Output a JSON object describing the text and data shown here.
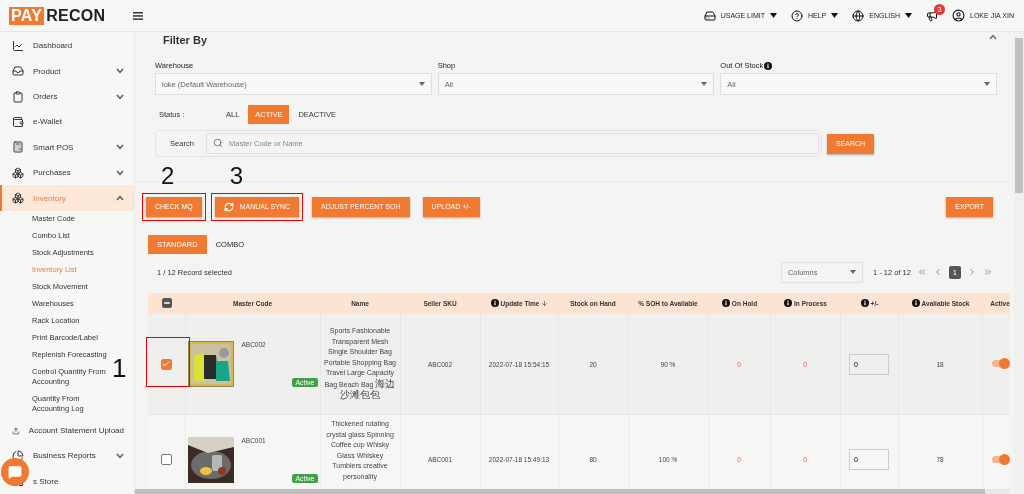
{
  "header": {
    "logo": {
      "part1": "PAY",
      "part2": "RECON"
    },
    "menu": [
      {
        "label": "USAGE LIMIT",
        "kind": "storage"
      },
      {
        "label": "HELP",
        "kind": "help"
      },
      {
        "label": "ENGLISH",
        "kind": "globe"
      }
    ],
    "notifications": {
      "count": "3"
    },
    "user": "LOKE JIA XIN"
  },
  "sidebar": {
    "items": [
      {
        "label": "Dashboard",
        "kind": "chart",
        "selected": false
      },
      {
        "label": "Product",
        "kind": "tray",
        "expanded": false,
        "selected": false
      },
      {
        "label": "Orders",
        "kind": "clipboard",
        "expanded": false,
        "selected": false
      },
      {
        "label": "e-Wallet",
        "kind": "wallet",
        "selected": false
      },
      {
        "label": "Smart POS",
        "kind": "register",
        "expanded": false,
        "selected": false
      },
      {
        "label": "Purchases",
        "kind": "boxes",
        "expanded": false,
        "selected": false
      },
      {
        "label": "Inventory",
        "kind": "boxes",
        "expanded": true,
        "selected": true,
        "children": [
          {
            "label": "Master Code",
            "selected": false
          },
          {
            "label": "Combo List",
            "selected": false
          },
          {
            "label": "Stock Adjustments",
            "selected": false
          },
          {
            "label": "Inventory List",
            "selected": true
          },
          {
            "label": "Stock Movement",
            "selected": false
          },
          {
            "label": "Warehouses",
            "selected": false
          },
          {
            "label": "Rack Location",
            "selected": false
          },
          {
            "label": "Print Barcode/Label",
            "selected": false
          },
          {
            "label": "Replenish Forecasting",
            "selected": false
          },
          {
            "label": "Control Quantity From Accounting",
            "selected": false
          },
          {
            "label": "Quantity From Accounting Log",
            "selected": false
          }
        ]
      },
      {
        "label": "Account Statement Upload",
        "kind": "upload",
        "selected": false
      },
      {
        "label": "Business Reports",
        "kind": "pie",
        "expanded": false,
        "selected": false
      },
      {
        "label": "s Store",
        "kind": "grid",
        "selected": false
      }
    ]
  },
  "filter": {
    "title": "Filter By",
    "fields": [
      {
        "label": "Warehouse",
        "value": "loke (Default Warehouse)",
        "info": false
      },
      {
        "label": "Shop",
        "value": "All",
        "info": false
      },
      {
        "label": "Out Of Stock",
        "value": "All",
        "info": true
      }
    ],
    "status": {
      "label": "Status :",
      "options": [
        {
          "label": "ALL",
          "selected": false
        },
        {
          "label": "ACTIVE",
          "selected": true
        },
        {
          "label": "DEACTIVE",
          "selected": false
        }
      ]
    },
    "search": {
      "label": "Search",
      "placeholder": "Master Code or Name",
      "button": "SEARCH"
    }
  },
  "actions": [
    {
      "label": "CHECK MQ",
      "kind": "plain",
      "annotation": "2"
    },
    {
      "label": "MANUAL SYNC",
      "kind": "sync",
      "annotation": "3"
    },
    {
      "label": "ADJUST PERCENT SOH",
      "kind": "plain"
    },
    {
      "label": "UPLOAD +/-",
      "kind": "plain"
    }
  ],
  "export": "EXPORT",
  "tabs": [
    {
      "label": "STANDARD",
      "selected": true
    },
    {
      "label": "COMBO",
      "selected": false
    }
  ],
  "record_count": "1 / 12 Record selected",
  "columns_select": "Columns",
  "pagination": {
    "range": "1 - 12 of 12",
    "page": "1"
  },
  "table": {
    "select_all_partial": true,
    "columns": [
      {
        "label": "Master Code",
        "info": false,
        "sorted": false
      },
      {
        "label": "Name",
        "info": false,
        "sorted": false
      },
      {
        "label": "Seller SKU",
        "info": false,
        "sorted": false
      },
      {
        "label": "Update Time",
        "info": true,
        "sorted": true
      },
      {
        "label": "Stock on Hand",
        "info": false,
        "sorted": false
      },
      {
        "label": "% SOH to Available",
        "info": false,
        "sorted": false
      },
      {
        "label": "On Hold",
        "info": true,
        "sorted": false
      },
      {
        "label": "In Process",
        "info": true,
        "sorted": false
      },
      {
        "label": "+/-",
        "info": true,
        "sorted": false
      },
      {
        "label": "Available Stock",
        "info": true,
        "sorted": false
      },
      {
        "label": "Active",
        "info": false,
        "sorted": false
      }
    ],
    "rows": [
      {
        "selected": true,
        "annotation": "1",
        "kind": "picture",
        "master_code": "ABC002",
        "status": "Active",
        "name": "Sports Fashionable Transparent Mesh Single Shoulder Bag Portable Shopping Bag Travel Large Capacity Bag Beach Bag 海边沙滩包包",
        "seller_sku": "ABC002",
        "update_time": "2022-07-18 15:54:15",
        "stock_on_hand": "20",
        "soh_percent": "90 %",
        "on_hold": "0",
        "in_process": "0",
        "adjust": "0",
        "available": "18",
        "active": true
      },
      {
        "selected": false,
        "kind": "picture",
        "master_code": "ABC001",
        "status": "Active",
        "name": "Thickened rotating crystal glass Spinning Coffee cup Whisky Glass Whiskey Tumblers creative personality",
        "seller_sku": "ABC001",
        "update_time": "2022-07-18 15:49:13",
        "stock_on_hand": "80",
        "soh_percent": "100 %",
        "on_hold": "0",
        "in_process": "0",
        "adjust": "0",
        "available": "78",
        "active": true
      }
    ]
  }
}
